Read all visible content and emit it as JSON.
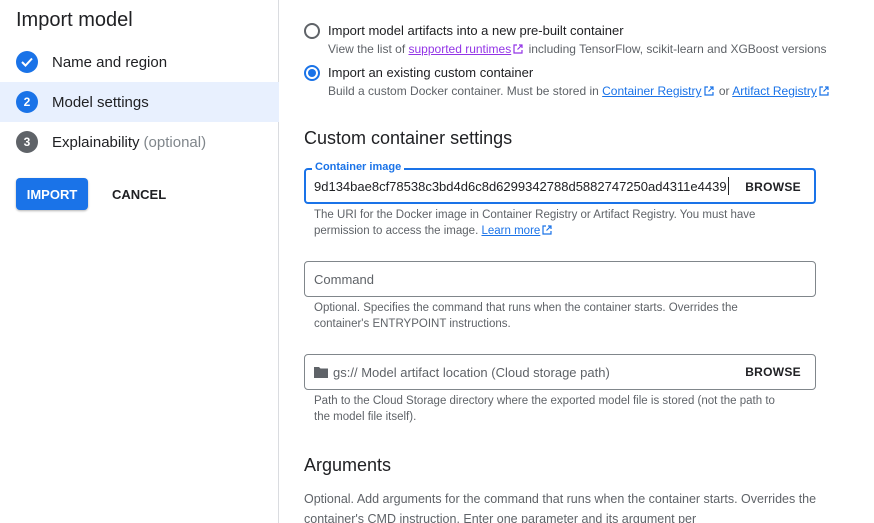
{
  "left": {
    "title": "Import model",
    "steps": [
      {
        "label": "Name and region",
        "state": "done"
      },
      {
        "label": "Model settings",
        "number": "2",
        "state": "active"
      },
      {
        "label": "Explainability",
        "optional": "(optional)",
        "number": "3",
        "state": "pending"
      }
    ],
    "import_label": "IMPORT",
    "cancel_label": "CANCEL"
  },
  "options": {
    "prebuilt": {
      "title": "Import model artifacts into a new pre-built container",
      "sub_before": "View the list of",
      "link": "supported runtimes",
      "sub_after": "including TensorFlow, scikit-learn and XGBoost versions",
      "selected": false
    },
    "custom": {
      "title": "Import an existing custom container",
      "sub_before": "Build a custom Docker container. Must be stored in",
      "link1": "Container Registry",
      "middle": "or",
      "link2": "Artifact Registry",
      "selected": true
    }
  },
  "custom_settings": {
    "heading": "Custom container settings",
    "container_image": {
      "label": "Container image",
      "value": "9d134bae8cf78538c3bd4d6c8d6299342788d5882747250ad4311e4439",
      "browse": "BROWSE",
      "hint_text": "The URI for the Docker image in Container Registry or Artifact Registry. You must have permission to access the image.",
      "hint_link": "Learn more"
    },
    "command": {
      "placeholder": "Command",
      "hint": "Optional. Specifies the command that runs when the container starts. Overrides the container's ENTRYPOINT instructions."
    },
    "artifact": {
      "prefix": "gs://",
      "placeholder": "Model artifact location (Cloud storage path)",
      "browse": "BROWSE",
      "hint": "Path to the Cloud Storage directory where the exported model file is stored (not the path to the model file itself)."
    }
  },
  "arguments": {
    "heading": "Arguments",
    "text": "Optional. Add arguments for the command that runs when the container starts. Overrides the container's CMD instruction. Enter one parameter and its argument per"
  },
  "colors": {
    "accent": "#1a73e8",
    "visited_link": "#9334e6",
    "active_step_bg": "#e8f0fe"
  }
}
